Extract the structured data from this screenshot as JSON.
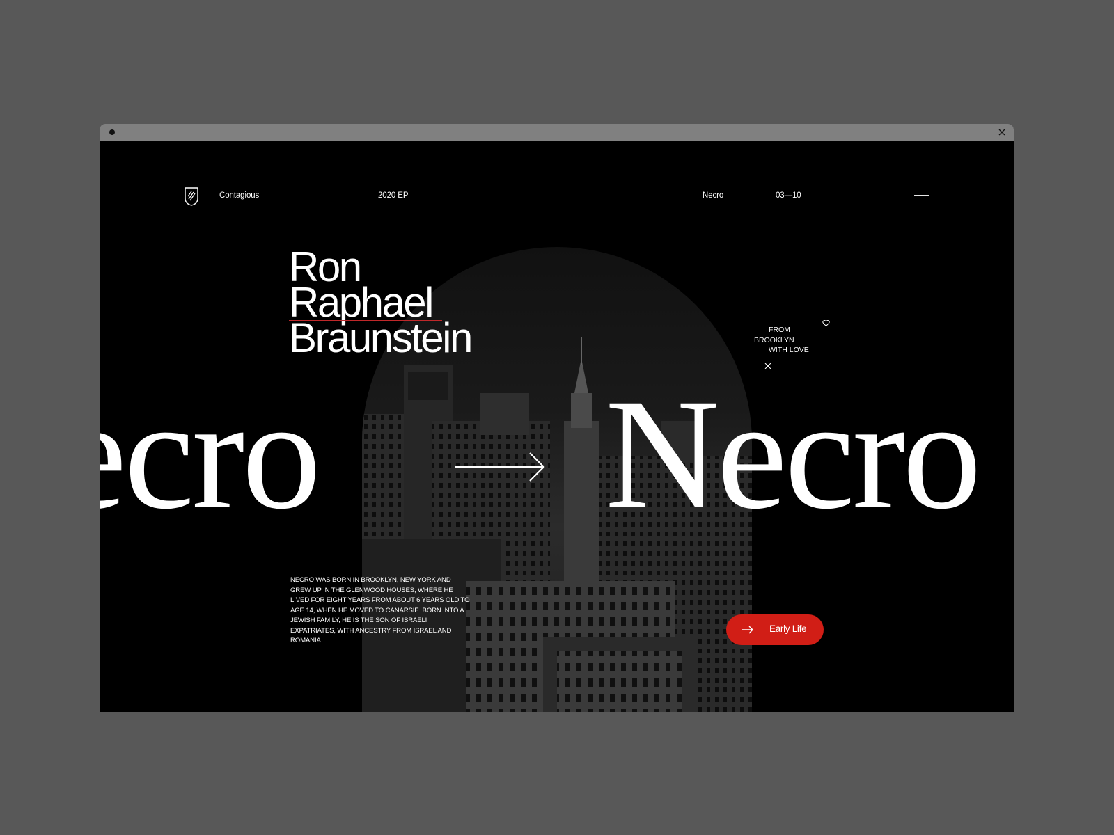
{
  "header": {
    "brand": "Contagious",
    "release": "2020 EP",
    "artist": "Necro",
    "pager": "03—10"
  },
  "hero": {
    "name_lines": [
      "Ron",
      "Raphael",
      "Braunstein"
    ],
    "big_word_left": "ecro",
    "big_word_right": "Necro",
    "tagline": [
      "FROM",
      "BROOKLYN",
      "WITH LOVE"
    ],
    "bio": "NECRO WAS BORN IN BROOKLYN, NEW YORK AND GREW UP IN THE GLENWOOD HOUSES, WHERE HE LIVED FOR EIGHT YEARS FROM ABOUT 6 YEARS OLD TO AGE 14, WHEN HE MOVED TO CANARSIE. BORN INTO A JEWISH FAMILY, HE IS THE SON OF ISRAELI EXPATRIATES, WITH ANCESTRY FROM ISRAEL AND ROMANIA."
  },
  "cta": {
    "label": "Early Life"
  },
  "colors": {
    "accent": "#d11e16",
    "background": "#000000",
    "frame": "#585858",
    "titlebar": "#808080"
  },
  "icons": {
    "logo": "shield-logo-icon",
    "menu": "hamburger-menu-icon",
    "heart": "heart-icon",
    "close": "close-icon",
    "arrow": "arrow-right-icon"
  }
}
